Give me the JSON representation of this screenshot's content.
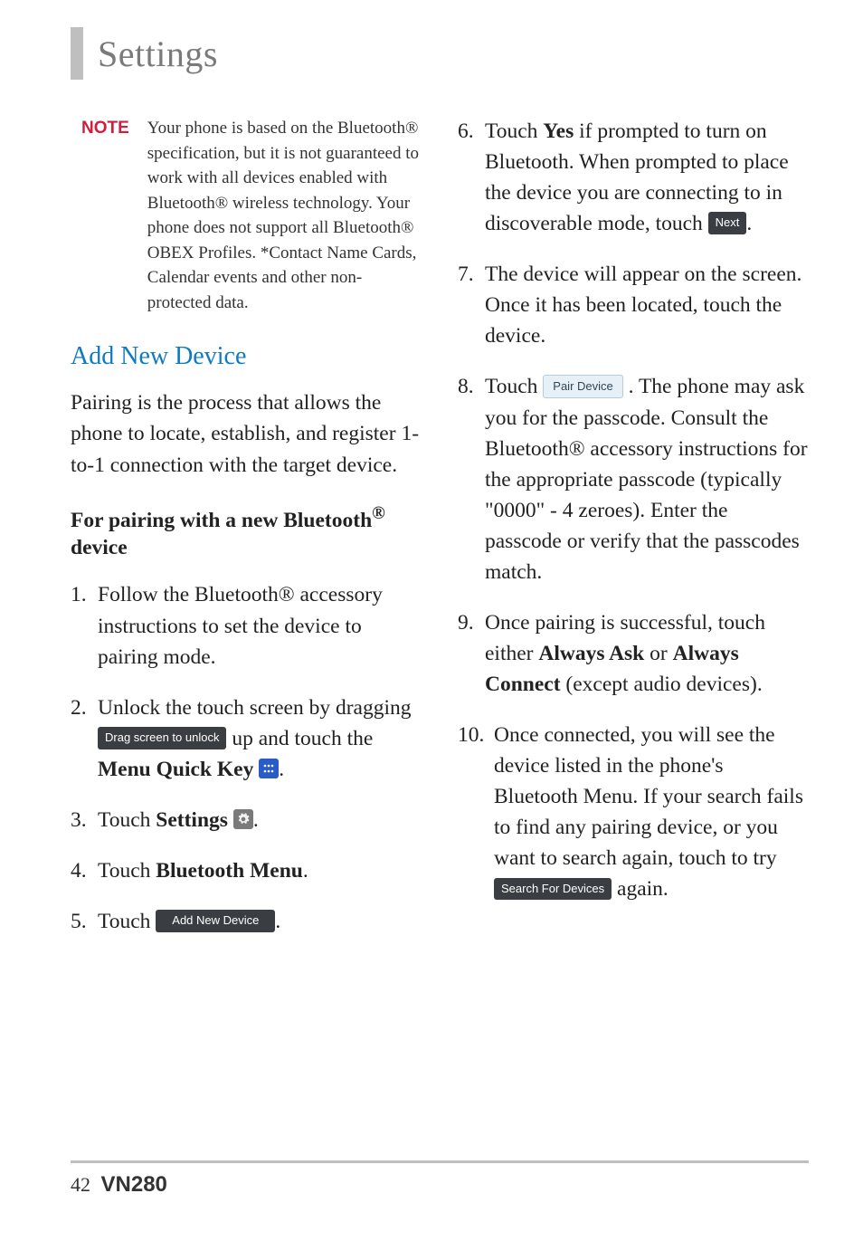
{
  "header": {
    "title": "Settings"
  },
  "note": {
    "label": "NOTE",
    "body": "Your phone is based on the Bluetooth® specification, but it is not guaranteed to work with all devices enabled with Bluetooth® wireless technology. Your phone does not support all Bluetooth® OBEX Profiles. *Contact Name Cards, Calendar events and other non-protected data."
  },
  "heading_blue": "Add New Device",
  "intro_para": "Pairing is the process that allows the phone to locate, establish, and register 1-to-1 connection with the target device.",
  "subheading_pre": "For pairing with a new Bluetooth",
  "subheading_sup": "®",
  "subheading_post": " device",
  "steps_left": {
    "s1": {
      "num": "1.",
      "body": "Follow the Bluetooth® accessory instructions to set the device to pairing mode."
    },
    "s2": {
      "num": "2.",
      "pre": "Unlock the touch screen by dragging ",
      "btn": "Drag screen to unlock",
      "mid": " up and touch the ",
      "bold": "Menu Quick Key ",
      "post": "."
    },
    "s3": {
      "num": "3.",
      "pre": "Touch ",
      "bold": "Settings ",
      "post": "."
    },
    "s4": {
      "num": "4.",
      "pre": "Touch ",
      "bold": "Bluetooth Menu",
      "post": "."
    },
    "s5": {
      "num": "5.",
      "pre": "Touch ",
      "btn": "Add New Device",
      "post": "."
    }
  },
  "steps_right": {
    "s6": {
      "num": "6.",
      "pre": "Touch ",
      "bold": "Yes",
      "mid": " if prompted to turn on Bluetooth. When prompted to place the device you are connecting to in discoverable mode, touch ",
      "btn": "Next",
      "post": "."
    },
    "s7": {
      "num": "7.",
      "body": "The device will appear on the screen. Once it has been located, touch the device."
    },
    "s8": {
      "num": "8.",
      "pre": "Touch ",
      "btn": "Pair Device",
      "post": " . The phone may ask you for the passcode. Consult the Bluetooth® accessory instructions for the appropriate passcode (typically \"0000\" - 4 zeroes). Enter the passcode or verify that the passcodes match."
    },
    "s9": {
      "num": "9.",
      "pre": "Once pairing is successful, touch either ",
      "bold1": "Always Ask",
      "mid": " or ",
      "bold2": "Always Connect",
      "post": " (except audio devices)."
    },
    "s10": {
      "num": "10.",
      "pre": "Once connected, you will see the device listed in the phone's Bluetooth Menu. If your search fails to find any pairing device, or you want to search again, touch to try ",
      "btn": "Search For Devices",
      "post": " again."
    }
  },
  "footer": {
    "page": "42",
    "model": "VN280"
  }
}
